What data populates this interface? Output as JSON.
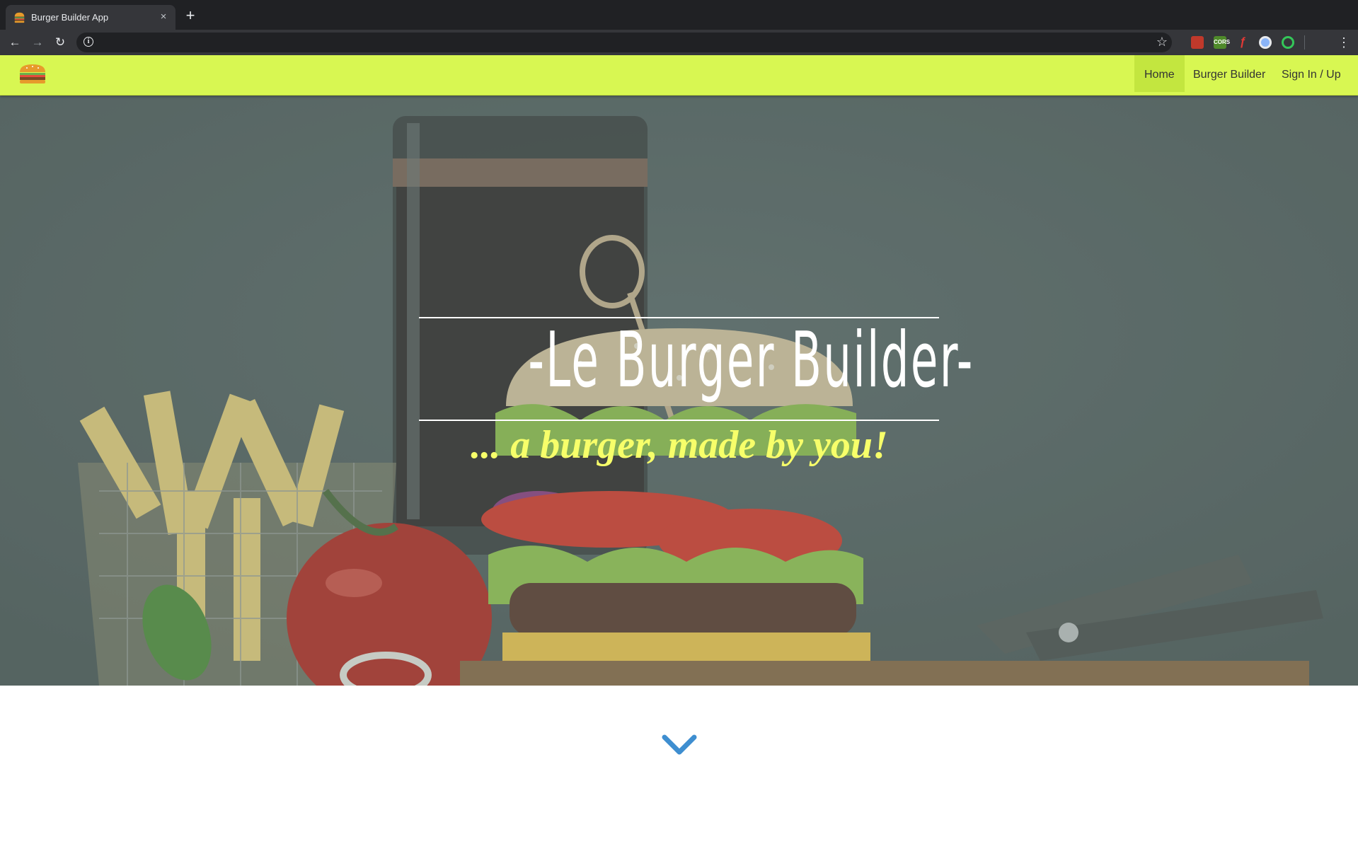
{
  "browser": {
    "tab_title": "Burger Builder App",
    "tab_close": "×",
    "new_tab": "+",
    "url": "",
    "back": "←",
    "forward": "→",
    "reload": "↻",
    "star": "☆",
    "menu": "⋮",
    "extensions": [
      "red-extension-icon",
      "cors-extension-icon",
      "flash-extension-icon",
      "blue-extension-icon",
      "green-target-extension-icon"
    ],
    "cors_label": "CORS"
  },
  "nav": {
    "items": [
      {
        "label": "Home",
        "active": true
      },
      {
        "label": "Burger Builder",
        "active": false
      },
      {
        "label": "Sign In / Up",
        "active": false
      }
    ],
    "bg_color": "#d8f752"
  },
  "hero": {
    "title": "-Le Burger Builder-",
    "tagline": "... a burger, made by you!",
    "tagline_color": "#f7ff6a"
  },
  "colors": {
    "accent": "#3e8ed0"
  }
}
